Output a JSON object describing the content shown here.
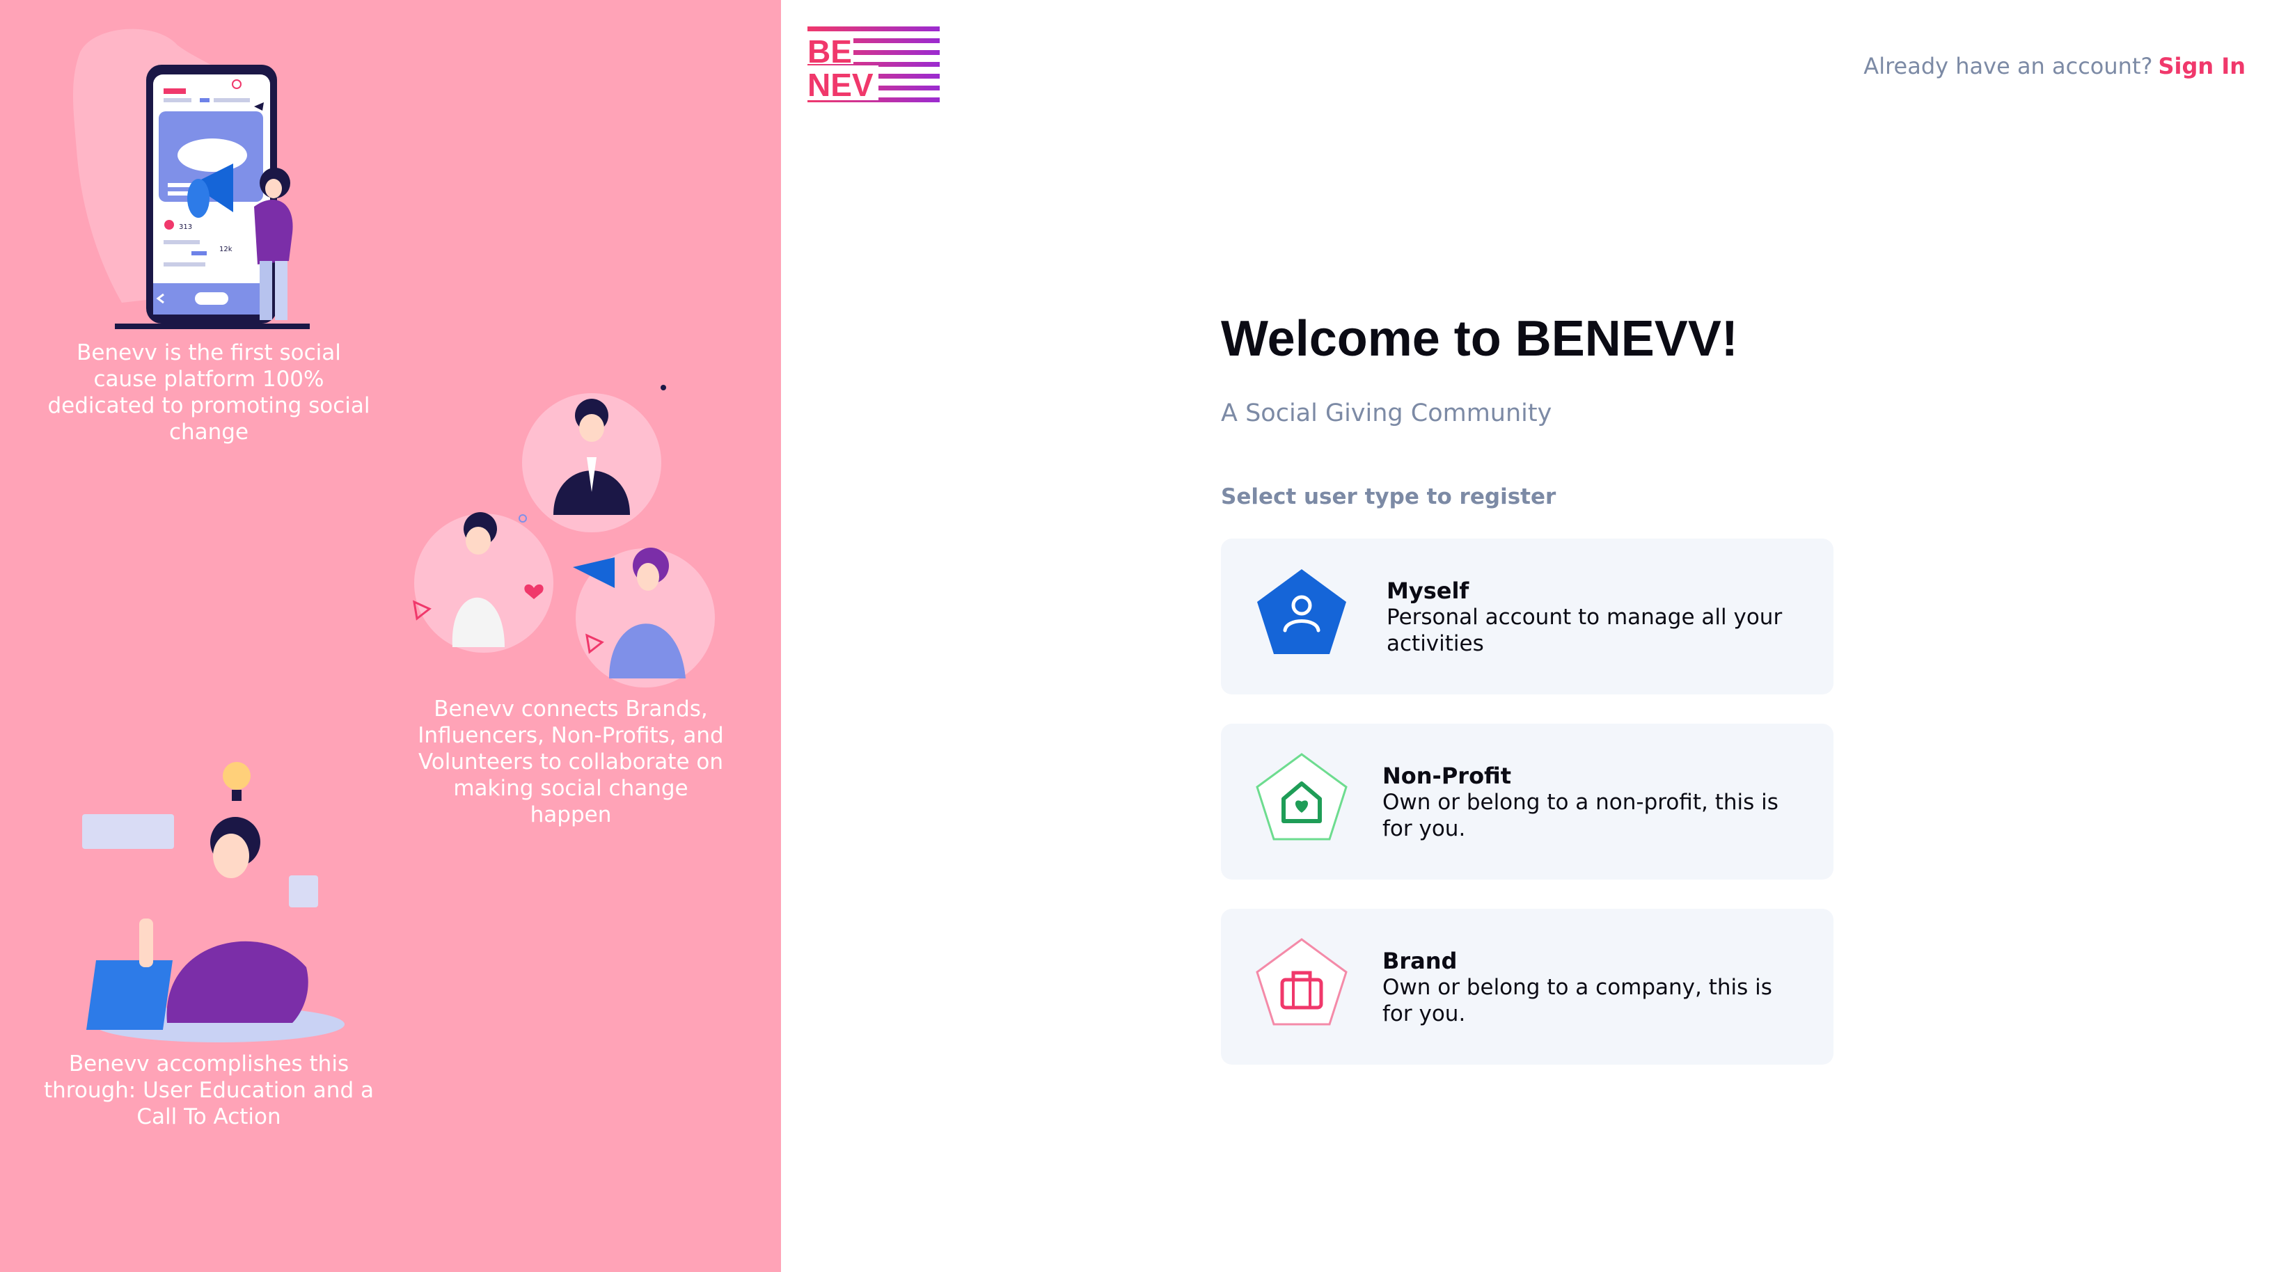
{
  "left_panel": {
    "captions": [
      "Benevv is the first social cause platform 100% dedicated to promoting social change",
      "Benevv connects Brands, Influencers, Non-Profits, and Volunteers to collaborate on making social change happen",
      "Benevv accomplishes this through: User Education and a Call To Action"
    ],
    "phone_stats": {
      "likes": "313",
      "shares": "12k"
    }
  },
  "logo": {
    "line1": "BE",
    "line2": "NEV"
  },
  "header": {
    "prompt": "Already have an account?",
    "signin": "Sign In"
  },
  "main": {
    "title": "Welcome to BENEVV!",
    "subtitle": "A Social Giving Community",
    "select_label": "Select user type to register"
  },
  "user_types": [
    {
      "title": "Myself",
      "description": "Personal account to manage all your activities",
      "color": "#1565d8",
      "icon": "person-icon"
    },
    {
      "title": "Non-Profit",
      "description": "Own or belong to a non-profit, this is for you.",
      "color": "#1f9d57",
      "icon": "home-heart-icon"
    },
    {
      "title": "Brand",
      "description": "Own or belong to a company, this is for you.",
      "color": "#f0386b",
      "icon": "briefcase-icon"
    }
  ],
  "colors": {
    "panel_pink": "#ffa3b7",
    "accent": "#f0386b",
    "muted": "#7c8aa5",
    "card_bg": "#f3f6fb"
  }
}
